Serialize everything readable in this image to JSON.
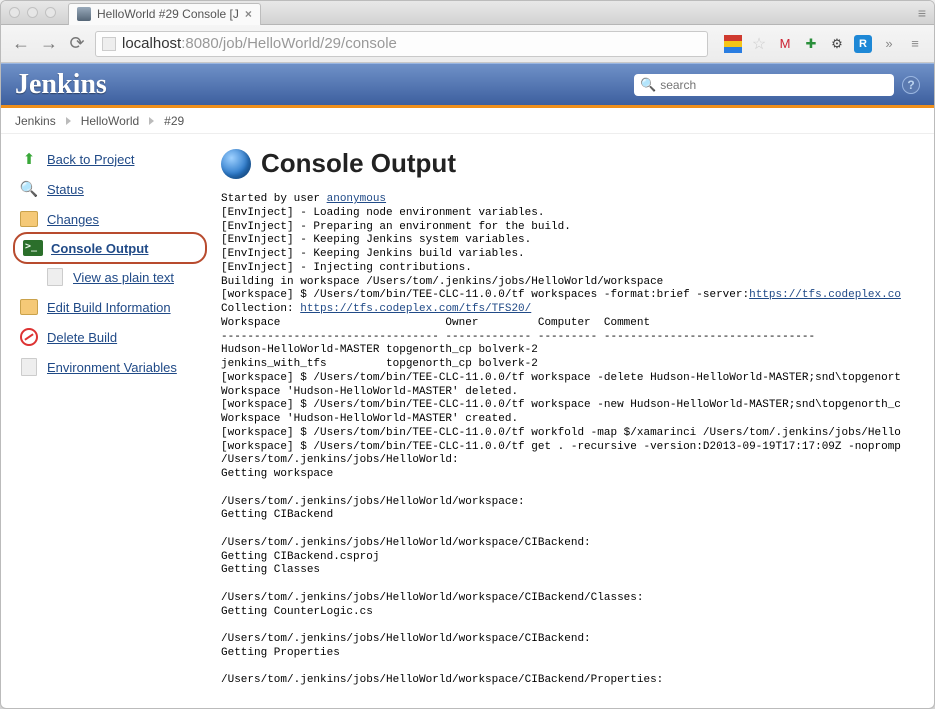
{
  "window": {
    "tab_title": "HelloWorld #29 Console [J"
  },
  "address": {
    "host": "localhost",
    "port_path": ":8080/job/HelloWorld/29/console"
  },
  "header": {
    "logo": "Jenkins",
    "search_placeholder": "search"
  },
  "breadcrumbs": [
    "Jenkins",
    "HelloWorld",
    "#29"
  ],
  "sidebar": {
    "back": "Back to Project",
    "status": "Status",
    "changes": "Changes",
    "console_output": "Console Output",
    "plain_text": "View as plain text",
    "edit_build": "Edit Build Information",
    "delete_build": "Delete Build",
    "env_vars": "Environment Variables"
  },
  "page": {
    "title": "Console Output",
    "started_prefix": "Started by user ",
    "started_user": "anonymous",
    "lines_before_collection": "[EnvInject] - Loading node environment variables.\n[EnvInject] - Preparing an environment for the build.\n[EnvInject] - Keeping Jenkins system variables.\n[EnvInject] - Keeping Jenkins build variables.\n[EnvInject] - Injecting contributions.\nBuilding in workspace /Users/tom/.jenkins/jobs/HelloWorld/workspace\n[workspace] $ /Users/tom/bin/TEE-CLC-11.0.0/tf workspaces -format:brief -server:",
    "link_tfs1": "https://tfs.codeplex.co",
    "collection_label": "Collection: ",
    "link_tfs2": "https://tfs.codeplex.com/tfs/TFS20/",
    "lines_after": "Workspace                         Owner         Computer  Comment\n--------------------------------- ------------- --------- --------------------------------\nHudson-HelloWorld-MASTER topgenorth_cp bolverk-2\njenkins_with_tfs         topgenorth_cp bolverk-2\n[workspace] $ /Users/tom/bin/TEE-CLC-11.0.0/tf workspace -delete Hudson-HelloWorld-MASTER;snd\\topgenort\nWorkspace 'Hudson-HelloWorld-MASTER' deleted.\n[workspace] $ /Users/tom/bin/TEE-CLC-11.0.0/tf workspace -new Hudson-HelloWorld-MASTER;snd\\topgenorth_c\nWorkspace 'Hudson-HelloWorld-MASTER' created.\n[workspace] $ /Users/tom/bin/TEE-CLC-11.0.0/tf workfold -map $/xamarinci /Users/tom/.jenkins/jobs/Hello\n[workspace] $ /Users/tom/bin/TEE-CLC-11.0.0/tf get . -recursive -version:D2013-09-19T17:17:09Z -nopromp\n/Users/tom/.jenkins/jobs/HelloWorld:\nGetting workspace\n\n/Users/tom/.jenkins/jobs/HelloWorld/workspace:\nGetting CIBackend\n\n/Users/tom/.jenkins/jobs/HelloWorld/workspace/CIBackend:\nGetting CIBackend.csproj\nGetting Classes\n\n/Users/tom/.jenkins/jobs/HelloWorld/workspace/CIBackend/Classes:\nGetting CounterLogic.cs\n\n/Users/tom/.jenkins/jobs/HelloWorld/workspace/CIBackend:\nGetting Properties\n\n/Users/tom/.jenkins/jobs/HelloWorld/workspace/CIBackend/Properties:"
  }
}
